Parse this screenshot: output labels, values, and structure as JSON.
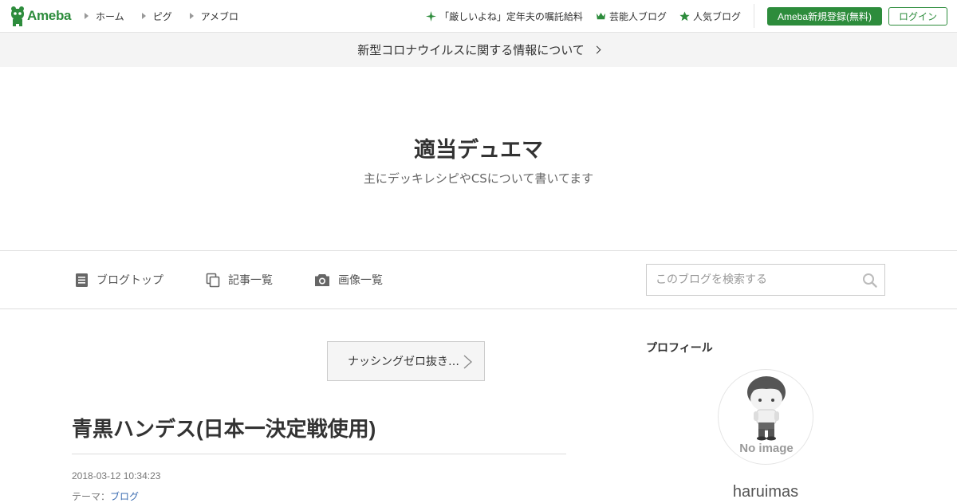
{
  "colors": {
    "brand": "#2d8c3c",
    "link": "#3a6bb0",
    "notice_bg": "#f4f4f4"
  },
  "header": {
    "logo_text": "Ameba",
    "nav": [
      {
        "label": "ホーム"
      },
      {
        "label": "ピグ"
      },
      {
        "label": "アメブロ"
      }
    ],
    "right_links": [
      {
        "label": "「厳しいよね」定年夫の嘱託給料",
        "icon": "sparkle-icon"
      },
      {
        "label": "芸能人ブログ",
        "icon": "crown-icon"
      },
      {
        "label": "人気ブログ",
        "icon": "star-icon"
      }
    ],
    "register_label": "Ameba新規登録(無料)",
    "login_label": "ログイン"
  },
  "notice": {
    "text": "新型コロナウイルスに関する情報について"
  },
  "blog": {
    "title": "適当デュエマ",
    "description": "主にデッキレシピやCSについて書いてます"
  },
  "menu": {
    "items": [
      {
        "label": "ブログトップ",
        "icon": "document-icon"
      },
      {
        "label": "記事一覧",
        "icon": "copy-icon"
      },
      {
        "label": "画像一覧",
        "icon": "camera-icon"
      }
    ],
    "search_placeholder": "このブログを検索する"
  },
  "article": {
    "prev_label": "ナッシングゼロ抜き…",
    "title": "青黒ハンデス(日本一決定戦使用)",
    "date": "2018-03-12 10:34:23",
    "theme_prefix": "テーマ：",
    "theme_link": "ブログ"
  },
  "sidebar": {
    "heading": "プロフィール",
    "avatar_caption": "No image",
    "username": "haruimas"
  }
}
